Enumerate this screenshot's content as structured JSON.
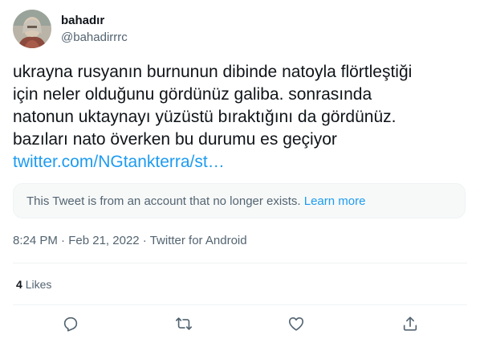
{
  "author": {
    "display_name": "bahadır",
    "handle": "@bahadirrrc"
  },
  "tweet": {
    "lines": [
      "ukrayna rusyanın burnunun dibinde natoyla flörtleştiği",
      "için neler olduğunu gördünüz galiba. sonrasında",
      "natonun uktaynayı yüzüstü bıraktığını da gördünüz.",
      "bazıları nato överken bu durumu es geçiyor"
    ],
    "link_text": "twitter.com/NGtankterra/st…"
  },
  "quoted_notice": {
    "text": "This Tweet is from an account that no longer exists.",
    "link_label": "Learn more"
  },
  "meta": {
    "time": "8:24 PM",
    "separator": "·",
    "date": "Feb 21, 2022",
    "source": "Twitter for Android"
  },
  "stats": {
    "likes_count": "4",
    "likes_label": "Likes"
  },
  "actions": {
    "icons": [
      "reply-icon",
      "retweet-icon",
      "like-icon",
      "share-icon"
    ]
  },
  "colors": {
    "link": "#1d9bf0",
    "secondary_text": "#536471",
    "primary_text": "#0f1419"
  }
}
